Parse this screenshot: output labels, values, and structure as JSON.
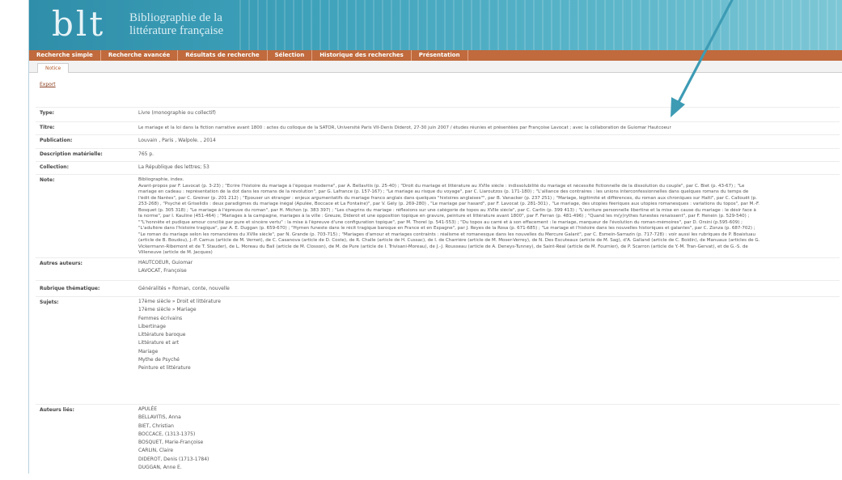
{
  "header": {
    "logo": "blt",
    "subtitle_line1": "Bibliographie de la",
    "subtitle_line2": "littérature française"
  },
  "menu": [
    "Recherche simple",
    "Recherche avancée",
    "Résultats de recherche",
    "Sélection",
    "Historique des recherches",
    "Présentation"
  ],
  "tab": "Notice",
  "export_label": "Export",
  "record": {
    "type_label": "Type:",
    "type_value": "Livre (monographie ou collectif)",
    "titre_label": "Titre:",
    "titre_value": "Le mariage et la loi dans la fiction narrative avant 1800 : actes du colloque de la SATOR, Université Paris VII-Denis Diderot, 27-30 juin 2007 / études réunies et présentées par Françoise Lavocat ; avec la collaboration de Guiomar Hautcoeur",
    "publication_label": "Publication:",
    "publication_value": "Louvain , Paris , Walpole. , 2014",
    "description_label": "Description matérielle:",
    "description_value": "765 p.",
    "collection_label": "Collection:",
    "collection_value": "La République des lettres; 53",
    "note_label": "Note:",
    "note_first": "Bibliographie, index.",
    "note_lines": [
      "Avant-propos par F. Lavocat (p. 3-23) ; \"Écrire l'histoire du mariage à l'époque moderne\", par A. Bellavitis (p. 25-40) ; \"Droit du mariage et littérature au XVIIe siècle : indissolubilité du mariage et nécessité fictionnelle de la dissolution du couple\", par C. Biet (p. 43-67) ; \"Le",
      "mariage en cadeau : représentation de la dot dans les romans de la révolution\", par G. Lafrance (p. 157-167) ; \"Le mariage au risque du voyage\", par C. Liaroutzos (p. 171-180) ; \"L'alliance des contraires : les unions interconfessionnelles dans quelques romans du temps de",
      "l'édit de Nantes\", par C. Greiner (p. 201 212) ; \"Épouser un étranger : enjeux argumentatifs du mariage franco anglais dans quelques \"histoires anglaises\"\", par B. Vanacker (p. 237 251) ; \"Mariage, légitimité et différences, du roman aux chroniques sur Haïti\", par C. Callouët (p.",
      "253-268) , \"Psyché et Griselidis : deux paradigmes du mariage inégal (Apulée, Boccace et La Fontaine)\", par V. Gély (p. 269-280) , \"Le mariage par hasard\", par F. Lavocat (p. 281-301) , \"Le mariage, des utopies féeriques aux utopies romanesques : variations du topos\", par M.-F.",
      "Bosquet (p. 305 318) ; \"Le mariage à l'épreuve du roman\", par H. Michon (p. 383 397) ; \"Les chagrins du mariage : réflexions sur une catégorie de topos au XVIIe siècle\", par C. Carlin (p. 399 413) ; \"L'écriture personnelle libertine et la mise en cause du mariage : le désir face à",
      "la norme\", par I. Kauline (451-464) ; \"Mariages à la campagne, mariages à la ville : Greuze, Diderot et une opposition topique en gravure, peinture et littérature avant 1800\", par F. Ferran (p. 481-496) ; \"Quand les m(y)rythes funestes renaissent\", par F. Henein (p. 529-540) ;",
      "\"\"L'honnête et pudique amour concilié par pure et sincère vertu\" : la mise à l'épreuve d'une configuration topique\", par M. Thorel (p. 541-553) ; \"Du topos au carré et à son effacement : le mariage, marqueur de l'évolution du roman-mémoires\", par D. Orsini (p.595-609) ;",
      "\"L'adultère dans l'histoire tragique\", par A. E. Duggan (p. 659-670) ; \"Hymen funeste dans le récit tragique baroque en France et en Espagne\", par J. Reyes de la Rosa (p. 671-685) ; \"Le mariage et l'histoire dans les nouvelles historiques et galantes\", par C. Zonza (p. 687-702) ;",
      "\"Le roman du mariage selon les romancières du XVIIe siècle\", par N. Grande (p. 703-715) ; \"Mariages d'amour et mariages contraints : réalisme et romanesque dans les nouvelles du Mercure Galant\", par C. Esmein-Sarrazin (p. 717-728) : voir aussi les rubriques de P. Boaistuau",
      "(article de B. Boudou), J.-P. Camus (article de M. Vernet), de C. Casanova (article de D. Coste), de R. Challe (article de H. Cussac), de I. de Charrière (article de M. Moser-Verrey), de N. Des Escuteaux (article de M. Sag), d'A. Galland (article de C. Boidin), de Manuaux (articles de G.",
      "Vickermann-Ribémont et de T. Stauder), de L. Moreau du Bail (article de M. Closson), de M. de Pure (article de I. Trivisani-Moreau), de J.-J. Rousseau (article de A. Deneys-Tunney), de Saint-Réal (article de M. Fournier), de P. Scarron (article de Y.-M. Tran-Gervat), et de G.-S. de",
      "Villeneuve (article de M. Jacques)"
    ],
    "autres_auteurs_label": "Autres auteurs:",
    "autres_auteurs": [
      "HAUTCOEUR, Guiomar",
      "LAVOCAT, Françoise"
    ],
    "rubrique_label": "Rubrique thématique:",
    "rubrique_value": "Généralités » Roman, conte, nouvelle",
    "sujets_label": "Sujets:",
    "sujets": [
      "17ème siècle » Droit et littérature",
      "17ème siècle » Mariage",
      "Femmes écrivains",
      "Libertinage",
      "Littérature baroque",
      "Littérature et art",
      "Mariage",
      "Mythe de Psyché",
      "Peinture et littérature"
    ],
    "auteurs_lies_label": "Auteurs liés:",
    "auteurs_lies": [
      "APULÉE",
      "BELLAVITIS, Anna",
      "BIET, Christian",
      "BOCCACE, (1313-1375)",
      "BOSQUET, Marie-Françoise",
      "CARLIN, Claire",
      "DIDEROT, Denis (1713-1784)",
      "DUGGAN, Anne E."
    ]
  },
  "colors": {
    "banner": "#3fa2bb",
    "menubar": "#c06a3d",
    "arrow": "#3d9bb4",
    "link": "#8a3f20"
  }
}
